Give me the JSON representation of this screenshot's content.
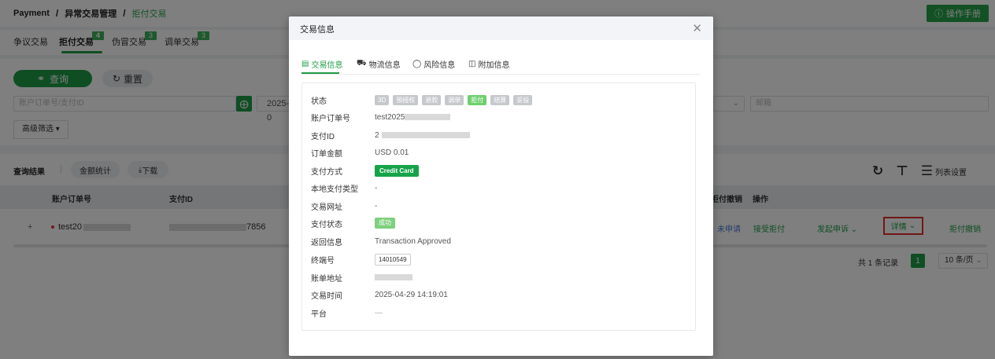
{
  "breadcrumb": {
    "app": "Payment",
    "section": "异常交易管理",
    "current": "拒付交易",
    "sep": "/"
  },
  "help_button": "操作手册",
  "page_tabs": [
    {
      "label": "争议交易",
      "badge": ""
    },
    {
      "label": "拒付交易",
      "badge": "4"
    },
    {
      "label": "伪冒交易",
      "badge": "3"
    },
    {
      "label": "调单交易",
      "badge": "3"
    }
  ],
  "filters": {
    "query_label": "查询",
    "reset_label": "重置",
    "order_placeholder": "账户订单号/支付ID",
    "date_value": "2025-0",
    "email_placeholder": "邮箱",
    "advanced_label": "高级筛选"
  },
  "results": {
    "title": "查询结果",
    "sep": "|",
    "amount_stats": "金额统计",
    "download": "下载",
    "column_settings": "列表设置",
    "columns": {
      "order_no": "账户订单号",
      "pay_id": "支付ID",
      "refuse_cancel": "拒付撤销",
      "actions": "操作"
    },
    "row": {
      "expand": "+",
      "order_prefix": "test20",
      "pay_suffix": "7856",
      "apply_status": "未申请",
      "accept": "接受拒付",
      "appeal": "发起申诉",
      "detail": "详情",
      "cancel": "拒付撤销"
    },
    "pager": {
      "total": "共 1 条记录",
      "page": "1",
      "size": "10 条/页"
    }
  },
  "modal": {
    "title": "交易信息",
    "tabs": [
      {
        "label": "交易信息",
        "icon": "list-icon"
      },
      {
        "label": "物流信息",
        "icon": "truck-icon"
      },
      {
        "label": "风险信息",
        "icon": "shield-icon"
      },
      {
        "label": "附加信息",
        "icon": "file-icon"
      }
    ],
    "status_label": "状态",
    "status_tags": [
      {
        "label": "3D",
        "active": false
      },
      {
        "label": "预授权",
        "active": false
      },
      {
        "label": "退款",
        "active": false
      },
      {
        "label": "调单",
        "active": false
      },
      {
        "label": "拒付",
        "active": true
      },
      {
        "label": "结算",
        "active": false
      },
      {
        "label": "妥投",
        "active": false
      }
    ],
    "fields": {
      "order_no": {
        "label": "账户订单号",
        "value": "test2025"
      },
      "pay_id": {
        "label": "支付ID",
        "value": "2"
      },
      "amount": {
        "label": "订单金额",
        "value": "USD 0.01"
      },
      "pay_method": {
        "label": "支付方式",
        "value": "Credit Card"
      },
      "local_type": {
        "label": "本地支付类型",
        "value": "-"
      },
      "site": {
        "label": "交易网址",
        "value": "-"
      },
      "pay_status": {
        "label": "支付状态",
        "value": "成功"
      },
      "return_info": {
        "label": "返回信息",
        "value": "Transaction Approved"
      },
      "terminal": {
        "label": "终端号",
        "value": "14010549"
      },
      "bill_addr": {
        "label": "账单地址",
        "value": ""
      },
      "trans_time": {
        "label": "交易时间",
        "value": "2025-04-29 14:19:01"
      },
      "platform": {
        "label": "平台",
        "value": "—"
      }
    }
  },
  "colors": {
    "accent": "#1f9d46",
    "highlight_border": "#e0302c"
  }
}
